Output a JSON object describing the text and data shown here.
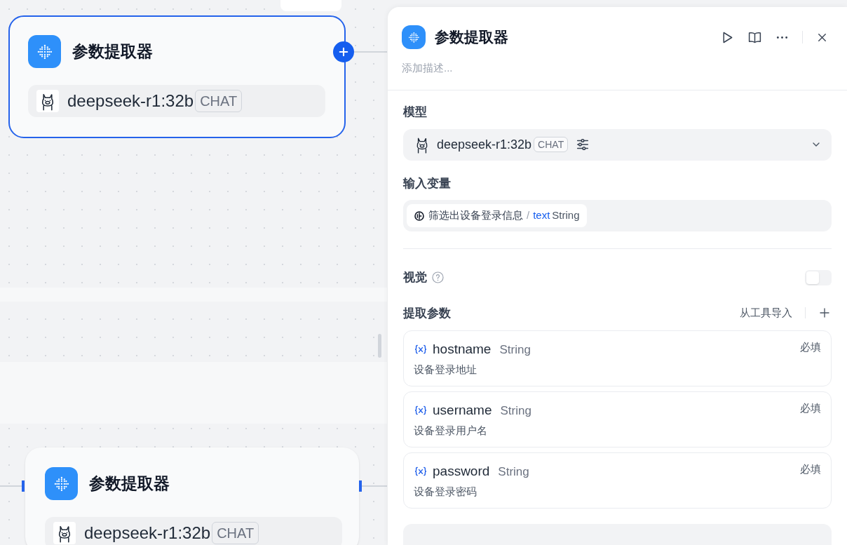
{
  "canvas": {
    "nodes": [
      {
        "title": "参数提取器",
        "model": "deepseek-r1:32b",
        "tag": "CHAT",
        "selected": true
      },
      {
        "title": "参数提取器",
        "model": "deepseek-r1:32b",
        "tag": "CHAT",
        "selected": false
      }
    ]
  },
  "panel": {
    "title": "参数提取器",
    "description": {
      "placeholder": "添加描述..."
    },
    "model_section": {
      "label": "模型",
      "model": "deepseek-r1:32b",
      "tag": "CHAT"
    },
    "input_section": {
      "label": "输入变量",
      "variable": {
        "node": "筛选出设备登录信息",
        "separator": "/",
        "name": "text",
        "type": "String"
      }
    },
    "vision": {
      "label": "视觉",
      "on": false
    },
    "params": {
      "label": "提取参数",
      "import_button": "从工具导入",
      "items": [
        {
          "name": "hostname",
          "type": "String",
          "required": "必填",
          "description": "设备登录地址"
        },
        {
          "name": "username",
          "type": "String",
          "required": "必填",
          "description": "设备登录用户名"
        },
        {
          "name": "password",
          "type": "String",
          "required": "必填",
          "description": "设备登录密码"
        }
      ]
    }
  }
}
